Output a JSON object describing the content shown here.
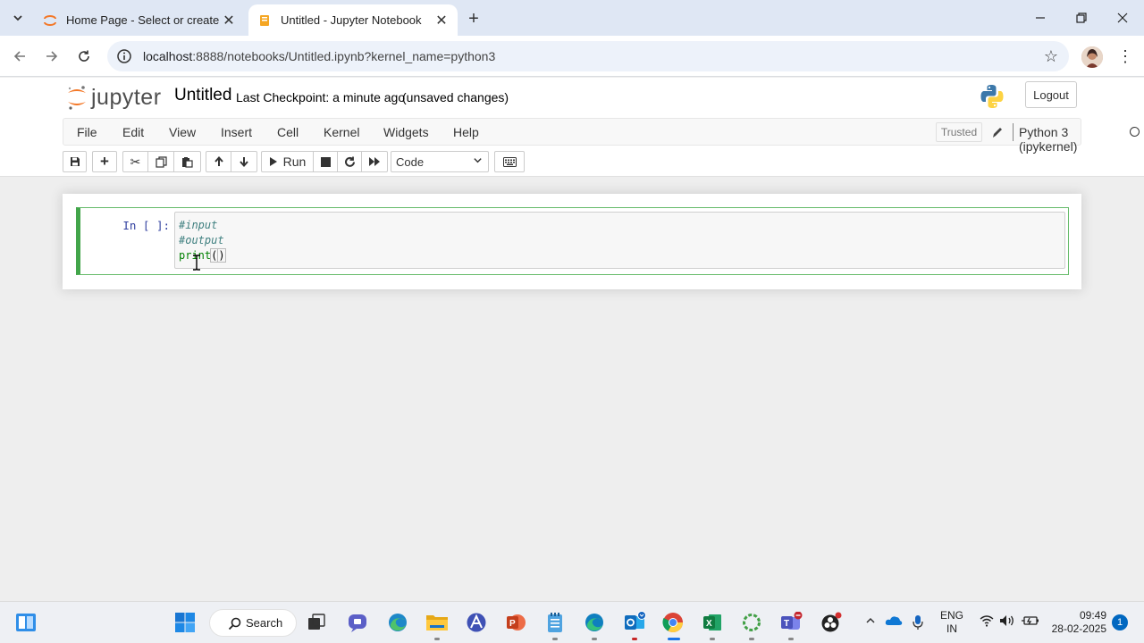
{
  "browser": {
    "tabs": [
      {
        "title": "Home Page - Select or create a",
        "active": false
      },
      {
        "title": "Untitled - Jupyter Notebook",
        "active": true
      }
    ],
    "url": "localhost:8888/notebooks/Untitled.ipynb?kernel_name=python3",
    "url_host": "localhost",
    "url_rest": ":8888/notebooks/Untitled.ipynb?kernel_name=python3"
  },
  "jupyter": {
    "logo_text": "jupyter",
    "notebook_name": "Untitled",
    "checkpoint": "Last Checkpoint: a minute ago",
    "unsaved": "(unsaved changes)",
    "logout": "Logout",
    "menu": [
      "File",
      "Edit",
      "View",
      "Insert",
      "Cell",
      "Kernel",
      "Widgets",
      "Help"
    ],
    "trusted": "Trusted",
    "kernel": "Python 3 (ipykernel)",
    "toolbar": {
      "run_label": "Run",
      "cell_type": "Code"
    }
  },
  "cell": {
    "prompt": "In [ ]:",
    "lines": [
      "#input",
      "#output",
      "print()"
    ],
    "comment1": "#input",
    "comment2": "#output",
    "builtin": "print",
    "open_paren": "(",
    "close_paren": ")"
  },
  "taskbar": {
    "search": "Search",
    "lang_line1": "ENG",
    "lang_line2": "IN",
    "time": "09:49",
    "date": "28-02-2025",
    "notification_count": "1"
  },
  "colors": {
    "cell_border": "#42a54a",
    "prompt_blue": "#303f9f",
    "comment": "#408080",
    "builtin": "#008000",
    "tabstrip": "#dfe7f4"
  }
}
